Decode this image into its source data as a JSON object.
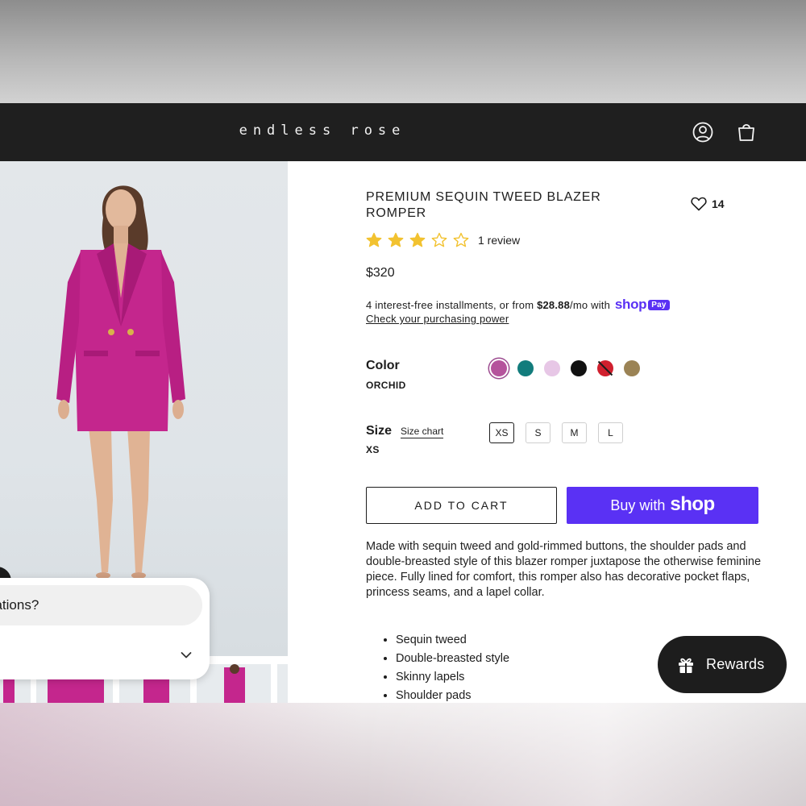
{
  "brand": {
    "logo_text": "endless rose"
  },
  "header": {
    "account_icon": "account-icon",
    "cart_icon": "shopping-bag-icon"
  },
  "product": {
    "title": "PREMIUM SEQUIN TWEED BLAZER ROMPER",
    "wishlist_count": "14",
    "rating": {
      "stars_filled": 3,
      "stars_total": 5,
      "review_text": "1 review"
    },
    "price": "$320",
    "installments": {
      "prefix": "4 interest-free installments, or from",
      "amount": "$28.88",
      "suffix": "/mo with",
      "brand": "shop",
      "badge": "Pay",
      "link": "Check your purchasing power"
    },
    "color": {
      "label": "Color",
      "selected": "ORCHID",
      "swatches": [
        {
          "hex": "#b5539c",
          "selected": true,
          "available": true
        },
        {
          "hex": "#127c7c",
          "selected": false,
          "available": true
        },
        {
          "hex": "#e7c7e6",
          "selected": false,
          "available": true
        },
        {
          "hex": "#111111",
          "selected": false,
          "available": true
        },
        {
          "hex": "#d0202e",
          "selected": false,
          "available": false
        },
        {
          "hex": "#9b8355",
          "selected": false,
          "available": true
        }
      ]
    },
    "size": {
      "label": "Size",
      "chart_link": "Size chart",
      "selected": "XS",
      "options": [
        "XS",
        "S",
        "M",
        "L"
      ]
    },
    "add_to_cart": "ADD TO CART",
    "buy_with": {
      "prefix": "Buy with",
      "brand": "shop"
    },
    "description": "Made with sequin tweed and gold-rimmed buttons, the shoulder pads and double-breasted style of this blazer romper juxtapose the otherwise feminine piece. Fully lined for comfort, this romper also has decorative pocket flaps, princess seams, and a lapel collar.",
    "features": [
      "Sequin tweed",
      "Double-breasted style",
      "Skinny lapels",
      "Shoulder pads"
    ]
  },
  "chat": {
    "bubble_text": "dations?"
  },
  "rewards": {
    "label": "Rewards"
  },
  "colors": {
    "accent_shop": "#5a31f4",
    "header_bg": "#1f1f1f",
    "star": "#f2c230",
    "product_pink": "#c4268d"
  }
}
